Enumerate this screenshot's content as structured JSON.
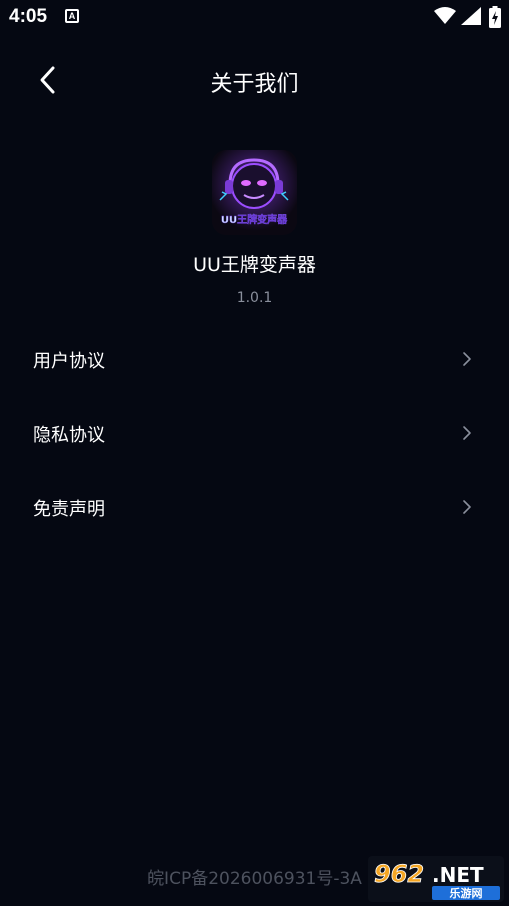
{
  "status_bar": {
    "time": "4:05",
    "notification_letter": "A"
  },
  "header": {
    "title": "关于我们"
  },
  "app": {
    "logo_text": "UU王牌变声器",
    "name": "UU王牌变声器",
    "version": "1.0.1"
  },
  "menu": [
    {
      "label": "用户协议"
    },
    {
      "label": "隐私协议"
    },
    {
      "label": "免责声明"
    }
  ],
  "footer": {
    "icp": "皖ICP备2026006931号-3A"
  },
  "watermark": {
    "number": "962",
    "suffix": ".NET",
    "site_name": "乐游网"
  },
  "colors": {
    "background": "#050812",
    "text": "#ffffff",
    "secondary_text": "#8a8f9c",
    "footer_text": "#4d525e",
    "logo_accent": "#9b4dff"
  }
}
